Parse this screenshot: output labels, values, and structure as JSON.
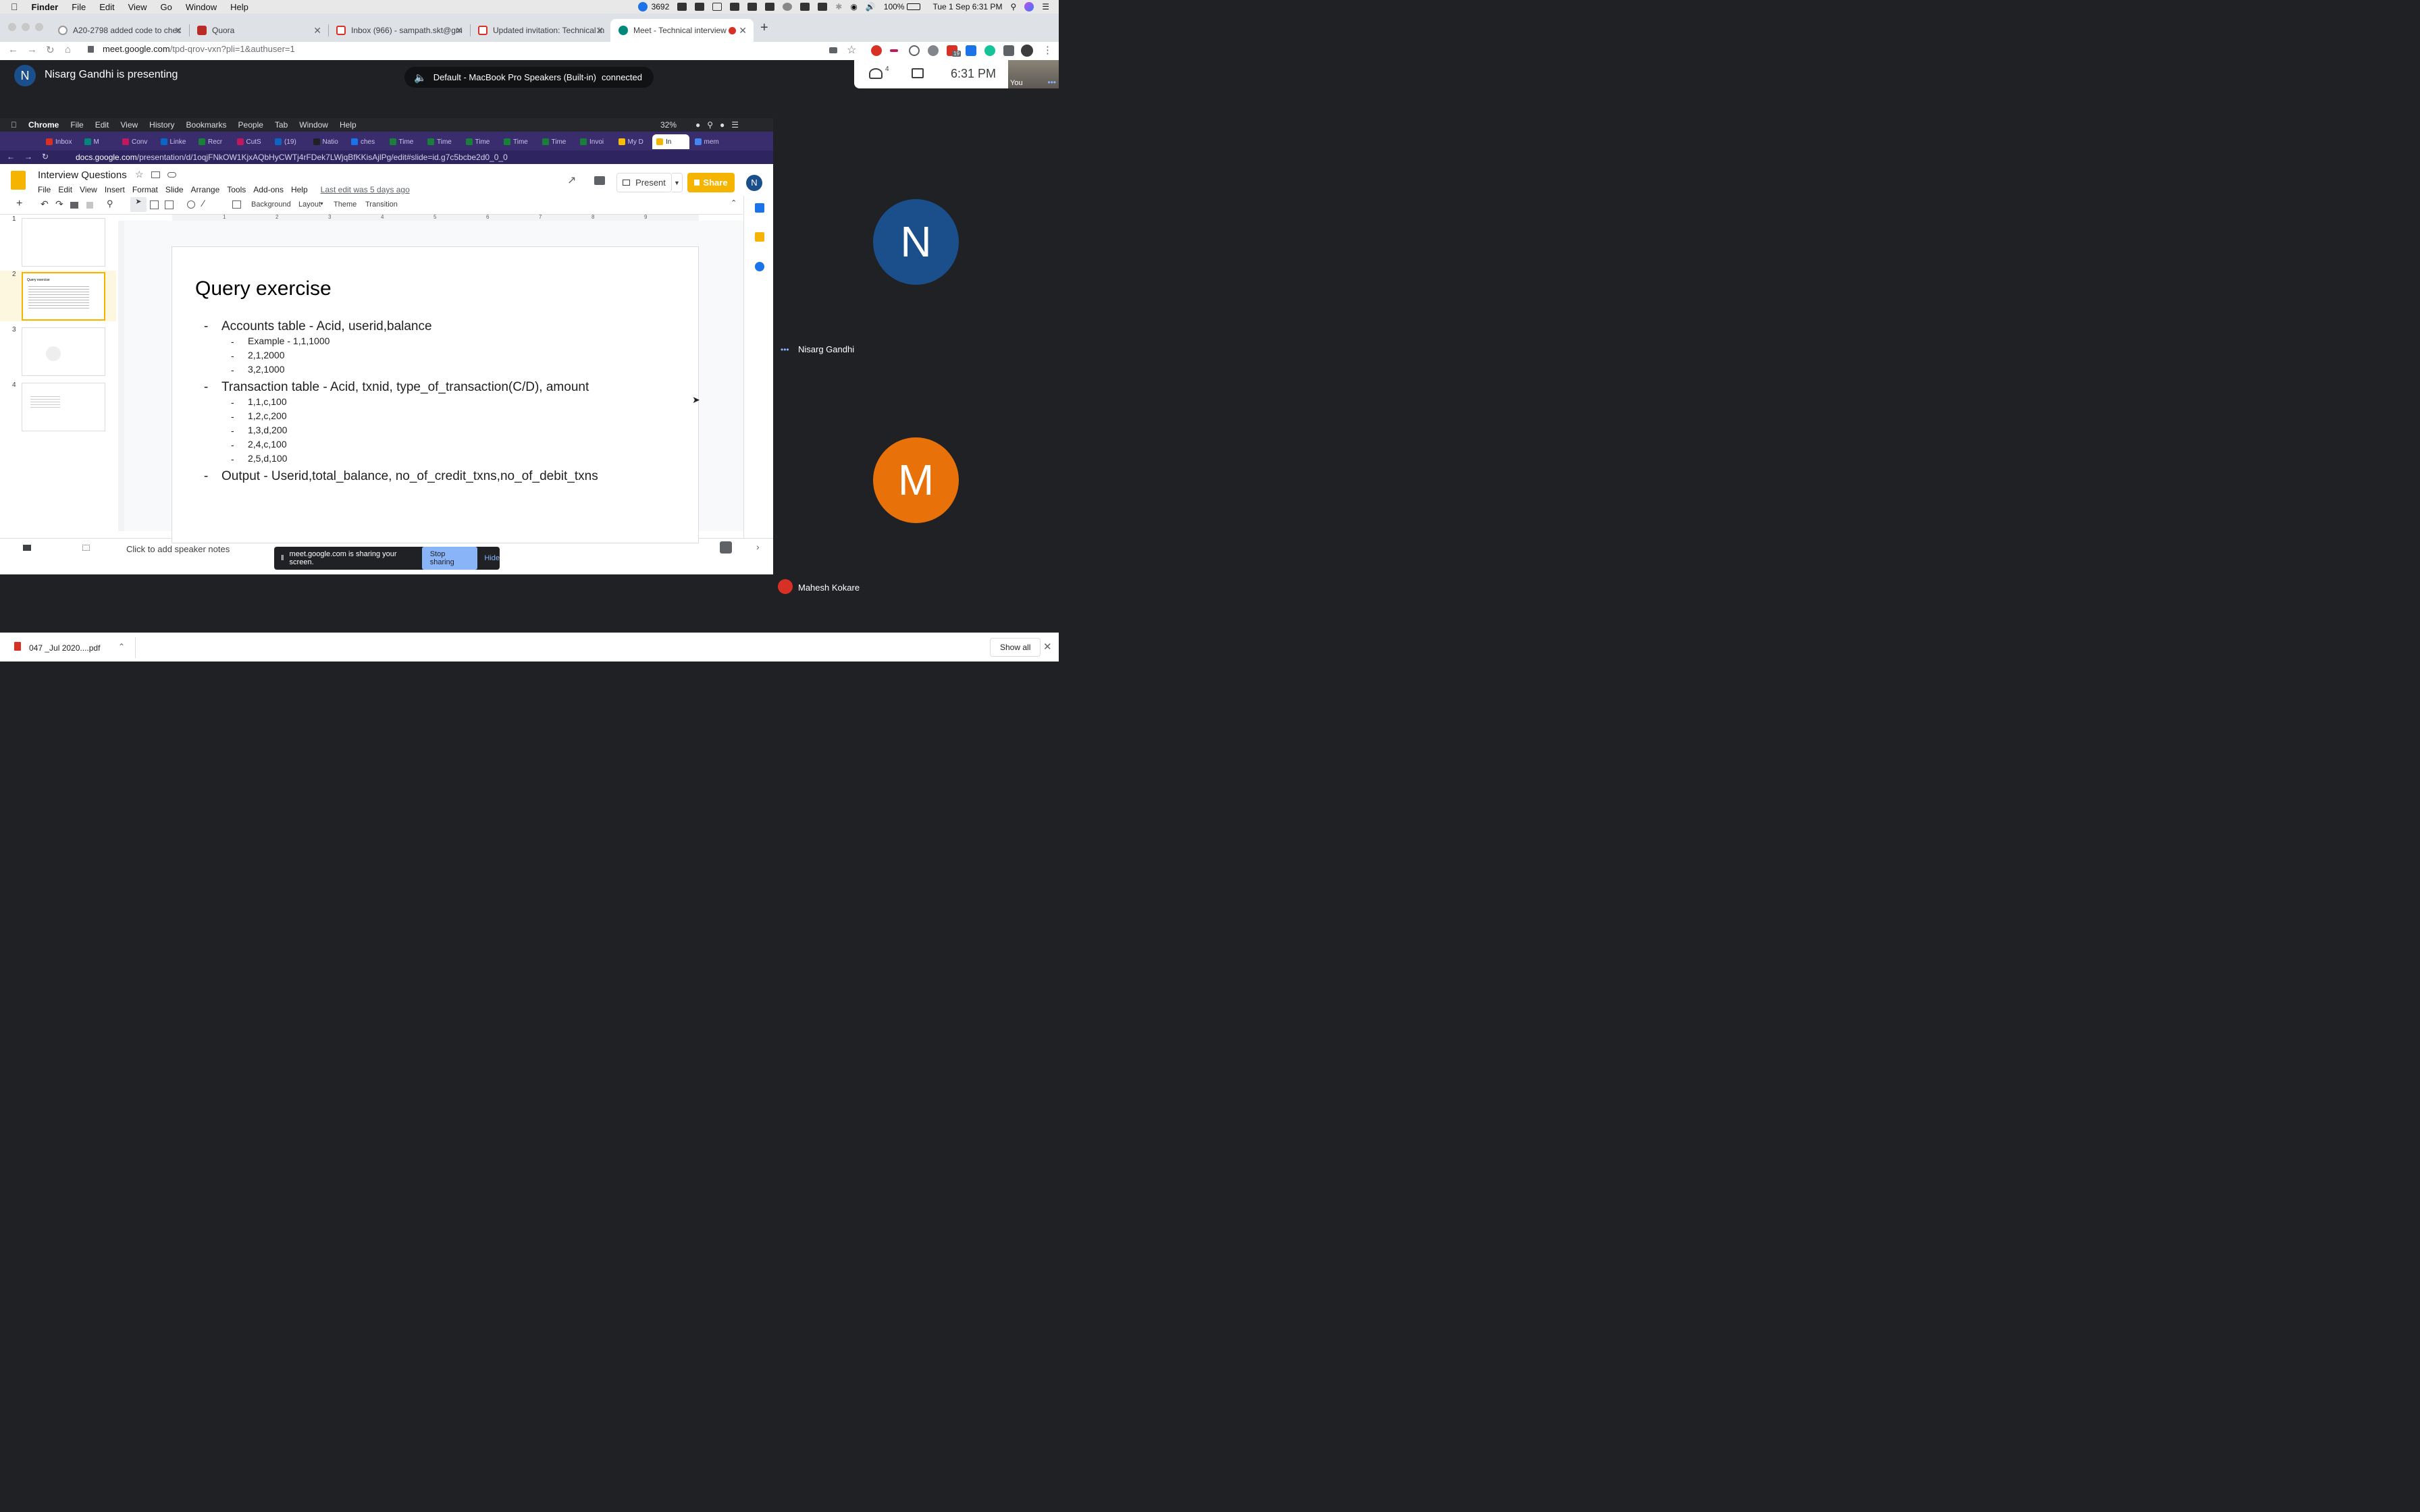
{
  "mac_menubar": {
    "app": "Finder",
    "items": [
      "File",
      "Edit",
      "View",
      "Go",
      "Window",
      "Help"
    ],
    "badge_count": "3692",
    "battery": "100%",
    "datetime": "Tue 1 Sep  6:31 PM"
  },
  "browser": {
    "tabs": [
      {
        "title": "A20-2798 added code to chec",
        "icon": "github-icon"
      },
      {
        "title": "Quora",
        "icon": "quora-icon"
      },
      {
        "title": "Inbox (966) - sampath.skt@gm",
        "icon": "gmail-icon"
      },
      {
        "title": "Updated invitation: Technical in",
        "icon": "gmail-icon"
      },
      {
        "title": "Meet - Technical interview",
        "icon": "meet-icon",
        "active": true
      }
    ],
    "url": {
      "host": "meet.google.com",
      "path": "/tpd-qrov-vxn?pli=1&authuser=1"
    },
    "ext_badge": "19"
  },
  "meet": {
    "presenter_initial": "N",
    "presenter_label": "Nisarg Gandhi is presenting",
    "speaker_status": {
      "device": "Default - MacBook Pro Speakers (Built-in)",
      "state": "connected"
    },
    "participants_count": "4",
    "time": "6:31 PM",
    "self_label": "You",
    "participants": [
      {
        "initial": "N",
        "name": "Nisarg Gandhi",
        "color": "#1a4f8b"
      },
      {
        "initial": "M",
        "name": "Mahesh Kokare",
        "color": "#e8710a",
        "muted": true
      }
    ],
    "share_banner": {
      "text": "meet.google.com is sharing your screen.",
      "stop": "Stop sharing",
      "hide": "Hide"
    }
  },
  "shared_screen": {
    "menubar": {
      "app": "Chrome",
      "items": [
        "File",
        "Edit",
        "View",
        "History",
        "Bookmarks",
        "People",
        "Tab",
        "Window",
        "Help"
      ],
      "battery": "32%"
    },
    "tabs": [
      "Inbox",
      "M",
      "Conv",
      "Linke",
      "Recr",
      "CutS",
      "(19) ",
      "Natio",
      "ches",
      "Time",
      "Time",
      "Time",
      "Time",
      "Time",
      "Invoi",
      "My D",
      "In",
      "mem"
    ],
    "url": {
      "host": "docs.google.com",
      "path": "/presentation/d/1oqjFNkOW1KjxAQbHyCWTj4rFDek7LWjqBfKKisAjlPg/edit#slide=id.g7c5bcbe2d0_0_0"
    },
    "slides": {
      "doc_title": "Interview Questions",
      "menu": [
        "File",
        "Edit",
        "View",
        "Insert",
        "Format",
        "Slide",
        "Arrange",
        "Tools",
        "Add-ons",
        "Help"
      ],
      "last_edit": "Last edit was 5 days ago",
      "present_label": "Present",
      "share_label": "Share",
      "user_initial": "N",
      "toolbar": {
        "background": "Background",
        "layout": "Layout",
        "theme": "Theme",
        "transition": "Transition"
      },
      "ruler_ticks": [
        "1",
        "2",
        "3",
        "4",
        "5",
        "6",
        "7",
        "8",
        "9"
      ],
      "thumbnails": [
        "1",
        "2",
        "3",
        "4"
      ],
      "selected_slide": 2,
      "notes_placeholder": "Click to add speaker notes",
      "slide": {
        "title": "Query exercise",
        "bullets": [
          {
            "text": "Accounts table - Acid, userid,balance",
            "sub": [
              "Example - 1,1,1000",
              "2,1,2000",
              "3,2,1000"
            ]
          },
          {
            "text": "Transaction table - Acid, txnid, type_of_transaction(C/D), amount",
            "sub": [
              "1,1,c,100",
              "1,2,c,200",
              "1,3,d,200",
              "2,4,c,100",
              "2,5,d,100"
            ]
          },
          {
            "text": "Output - Userid,total_balance, no_of_credit_txns,no_of_debit_txns",
            "sub": []
          }
        ]
      }
    }
  },
  "downloads": {
    "file": "047 _Jul 2020....pdf",
    "show_all": "Show all"
  }
}
